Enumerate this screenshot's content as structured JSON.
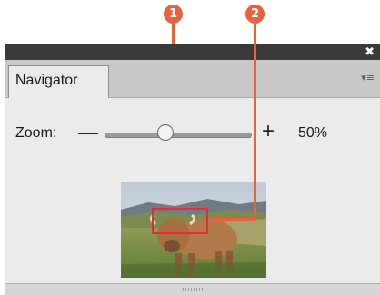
{
  "callouts": [
    "1",
    "2"
  ],
  "panel": {
    "close_glyph": "✖",
    "tab_label": "Navigator",
    "menu_glyph": "▾≡"
  },
  "zoom": {
    "label": "Zoom:",
    "minus_glyph": "—",
    "plus_glyph": "+",
    "value_text": "50%",
    "slider_fraction": 0.42
  },
  "thumbnail": {
    "subject": "highland cow on a grassy hillside"
  },
  "colors": {
    "callout": "#e8623c",
    "view_rect": "#e8293a",
    "titlebar": "#3a3a3a",
    "panel_bg": "#ebebeb"
  }
}
